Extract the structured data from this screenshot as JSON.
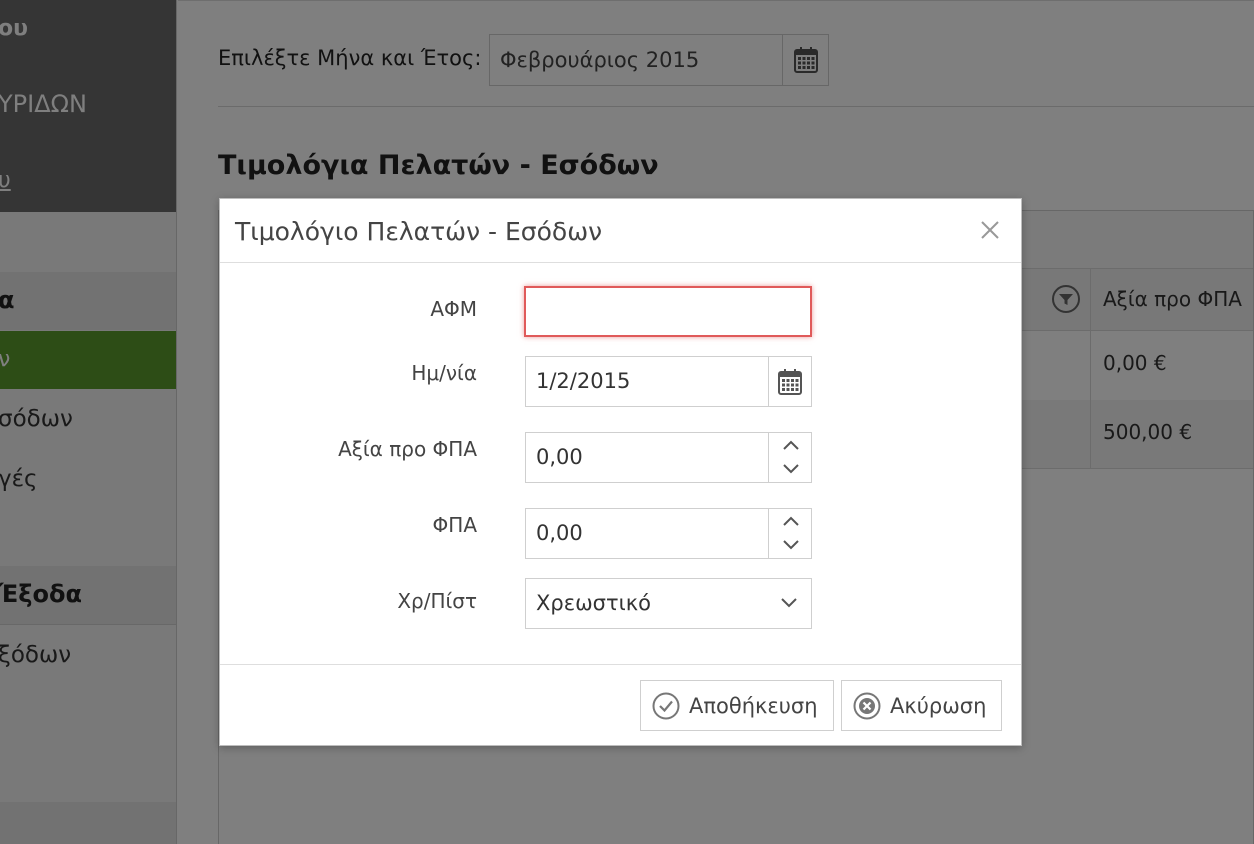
{
  "sidebar": {
    "header_line1": "ου",
    "header_line2": "ΥΡΙΔΩΝ",
    "header_line3": "υ",
    "section1_title": "α",
    "active_item": "ν",
    "item1": "σόδων",
    "item2": "γές",
    "section2_title": "Έξοδα",
    "item3": "ξόδων"
  },
  "filter": {
    "label": "Επιλέξτε Μήνα και Έτος:",
    "value": "Φεβρουάριος 2015"
  },
  "page_title": "Τιμολόγια Πελατών - Εσόδων",
  "grid": {
    "column_header": "Αξία προ ΦΠΑ",
    "rows": [
      "0,00 €",
      "500,00 €"
    ]
  },
  "dialog": {
    "title": "Τιμολόγιο Πελατών - Εσόδων",
    "fields": {
      "afm_label": "ΑΦΜ",
      "afm_value": "",
      "date_label": "Ημ/νία",
      "date_value": "1/2/2015",
      "net_label": "Αξία προ ΦΠΑ",
      "net_value": "0,00",
      "vat_label": "ΦΠΑ",
      "vat_value": "0,00",
      "type_label": "Χρ/Πίστ",
      "type_value": "Χρεωστικό"
    },
    "save_label": "Αποθήκευση",
    "cancel_label": "Ακύρωση"
  },
  "colors": {
    "accent_green": "#5b9a2c",
    "error_red": "#e05a5a"
  }
}
